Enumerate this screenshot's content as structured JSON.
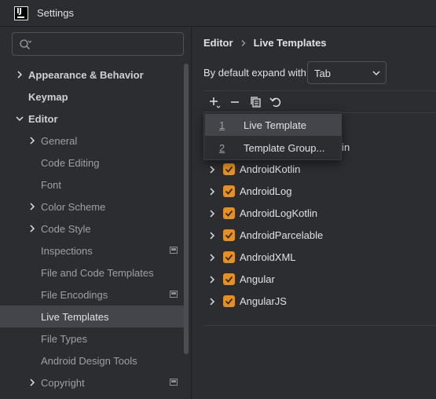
{
  "window": {
    "title": "Settings"
  },
  "search": {
    "placeholder": "",
    "value": ""
  },
  "sidebar": {
    "items": [
      {
        "label": "Appearance & Behavior",
        "level": 0,
        "expandable": true,
        "expanded": false,
        "bold": true
      },
      {
        "label": "Keymap",
        "level": 0,
        "expandable": false,
        "bold": true
      },
      {
        "label": "Editor",
        "level": 0,
        "expandable": true,
        "expanded": true,
        "bold": true
      },
      {
        "label": "General",
        "level": 1,
        "expandable": true,
        "expanded": false
      },
      {
        "label": "Code Editing",
        "level": 1,
        "expandable": false
      },
      {
        "label": "Font",
        "level": 1,
        "expandable": false
      },
      {
        "label": "Color Scheme",
        "level": 1,
        "expandable": true,
        "expanded": false
      },
      {
        "label": "Code Style",
        "level": 1,
        "expandable": true,
        "expanded": false
      },
      {
        "label": "Inspections",
        "level": 1,
        "expandable": false,
        "project_icon": true
      },
      {
        "label": "File and Code Templates",
        "level": 1,
        "expandable": false
      },
      {
        "label": "File Encodings",
        "level": 1,
        "expandable": false,
        "project_icon": true
      },
      {
        "label": "Live Templates",
        "level": 1,
        "expandable": false,
        "selected": true
      },
      {
        "label": "File Types",
        "level": 1,
        "expandable": false
      },
      {
        "label": "Android Design Tools",
        "level": 1,
        "expandable": false
      },
      {
        "label": "Copyright",
        "level": 1,
        "expandable": true,
        "expanded": false,
        "project_icon": true
      }
    ]
  },
  "breadcrumb": {
    "parent": "Editor",
    "current": "Live Templates"
  },
  "expand_with": {
    "label": "By default expand with",
    "value": "Tab"
  },
  "toolbar": {
    "icons": [
      "add-icon",
      "remove-icon",
      "copy-icon",
      "restore-icon"
    ]
  },
  "popup": {
    "items": [
      {
        "number": "1",
        "label": "Live Template",
        "active": true
      },
      {
        "number": "2",
        "label": "Template Group...",
        "active": false
      }
    ]
  },
  "templates": [
    {
      "name": "AndroidCommentsKotlin",
      "checked": true
    },
    {
      "name": "AndroidKotlin",
      "checked": true
    },
    {
      "name": "AndroidLog",
      "checked": true
    },
    {
      "name": "AndroidLogKotlin",
      "checked": true
    },
    {
      "name": "AndroidParcelable",
      "checked": true
    },
    {
      "name": "AndroidXML",
      "checked": true
    },
    {
      "name": "Angular",
      "checked": true
    },
    {
      "name": "AngularJS",
      "checked": true
    }
  ],
  "colors": {
    "background": "#2b2d30",
    "selection": "#43454a",
    "checkbox": "#e8901f",
    "text": "#dfe1e5",
    "muted_text": "#9da0a8"
  }
}
